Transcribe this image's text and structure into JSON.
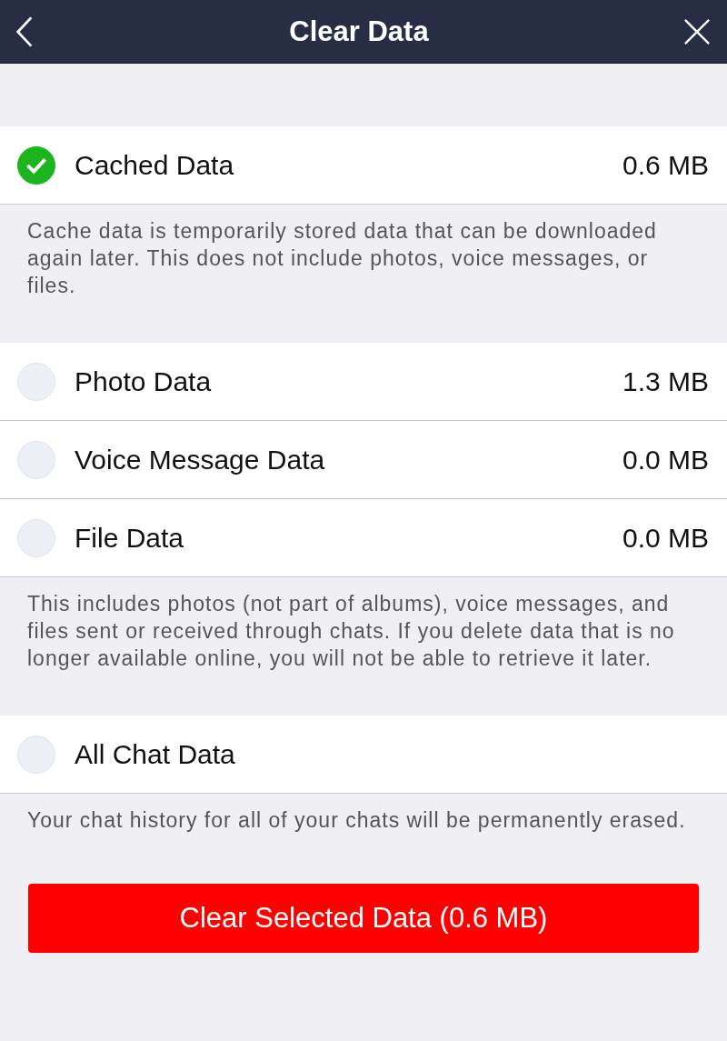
{
  "header": {
    "title": "Clear Data"
  },
  "sections": [
    {
      "items": [
        {
          "label": "Cached Data",
          "size": "0.6 MB",
          "checked": true
        }
      ],
      "note": "Cache data is temporarily stored data that can be downloaded again later. This does not include photos, voice messages, or files."
    },
    {
      "items": [
        {
          "label": "Photo Data",
          "size": "1.3 MB",
          "checked": false
        },
        {
          "label": "Voice Message Data",
          "size": "0.0 MB",
          "checked": false
        },
        {
          "label": "File Data",
          "size": "0.0 MB",
          "checked": false
        }
      ],
      "note": "This includes photos (not part of albums), voice messages, and files sent or received through chats. If you delete data that is no longer available online, you will not be able to retrieve it later."
    },
    {
      "items": [
        {
          "label": "All Chat Data",
          "checked": false
        }
      ],
      "note": "Your chat history for all of your chats will be permanently erased."
    }
  ],
  "button": {
    "label": "Clear Selected Data (0.6 MB)"
  }
}
